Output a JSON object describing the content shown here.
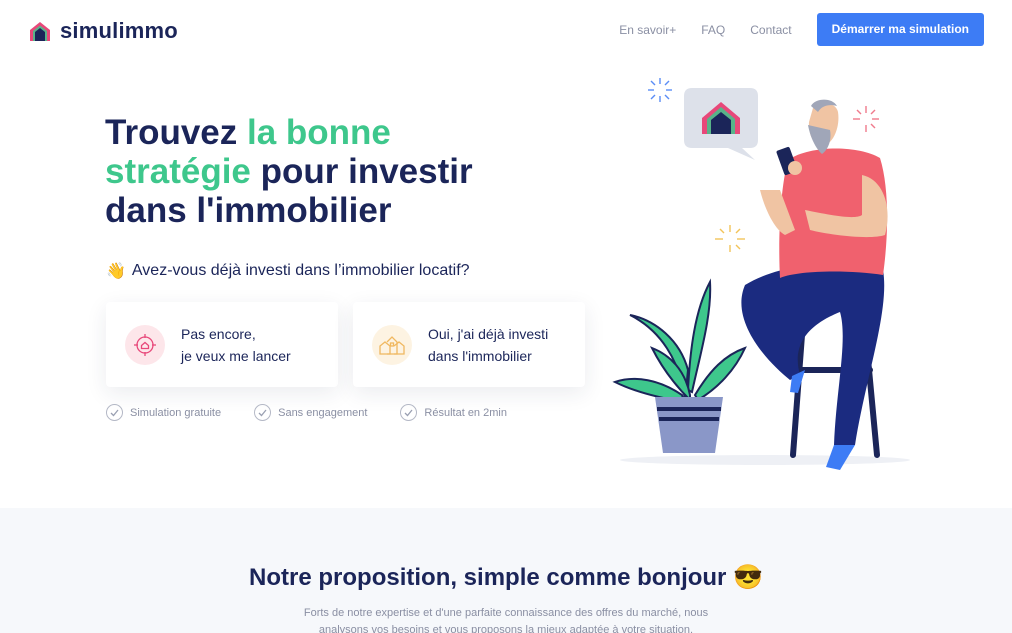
{
  "header": {
    "brand": "simulimmo",
    "nav": [
      "En savoir+",
      "FAQ",
      "Contact"
    ],
    "cta_label": "Démarrer ma simulation"
  },
  "hero": {
    "title_part1": "Trouvez ",
    "title_accent1": "la bonne stratégie",
    "title_part2": " pour investir dans l'immobilier",
    "question_emoji": "👋",
    "question": "Avez-vous déjà investi dans l’immobilier locatif?",
    "option1": {
      "line1": "Pas encore,",
      "line2": "je veux me lancer",
      "icon": "target-home-icon"
    },
    "option2": {
      "line1": "Oui, j'ai déjà investi",
      "line2": "dans l'immobilier",
      "icon": "houses-icon"
    },
    "features": [
      "Simulation gratuite",
      "Sans engagement",
      "Résultat en 2min"
    ]
  },
  "section2": {
    "title": "Notre proposition, simple comme bonjour 😎",
    "text": "Forts de notre expertise et d'une parfaite connaissance des offres du marché, nous analysons vos besoins et vous proposons la mieux adaptée à votre situation."
  },
  "colors": {
    "navy": "#1b2559",
    "accent_green": "#3ec78c",
    "cta_blue": "#3d7cf5",
    "muted": "#8a8fa3"
  }
}
